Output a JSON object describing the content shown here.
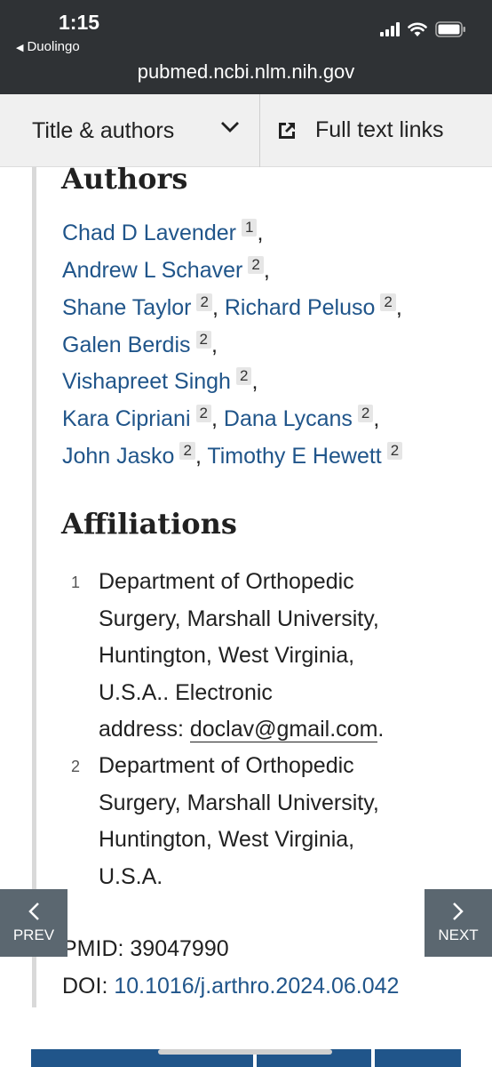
{
  "status": {
    "time": "1:15",
    "back_app": "Duolingo"
  },
  "url": "pubmed.ncbi.nlm.nih.gov",
  "toolbar": {
    "title_authors": "Title & authors",
    "full_text": "Full text links"
  },
  "authors_heading": "Authors",
  "authors": {
    "a1": {
      "name": "Chad D Lavender",
      "sup": "1"
    },
    "a2": {
      "name": "Andrew L Schaver",
      "sup": "2"
    },
    "a3": {
      "name": "Shane Taylor",
      "sup": "2"
    },
    "a4": {
      "name": "Richard Peluso",
      "sup": "2"
    },
    "a5": {
      "name": "Galen Berdis",
      "sup": "2"
    },
    "a6": {
      "name": "Vishapreet Singh",
      "sup": "2"
    },
    "a7": {
      "name": "Kara Cipriani",
      "sup": "2"
    },
    "a8": {
      "name": "Dana Lycans",
      "sup": "2"
    },
    "a9": {
      "name": "John Jasko",
      "sup": "2"
    },
    "a10": {
      "name": "Timothy E Hewett",
      "sup": "2"
    }
  },
  "affiliations_heading": "Affiliations",
  "affiliations": {
    "one": {
      "num": "1",
      "l1": "Department of Orthopedic",
      "l2": "Surgery, Marshall University,",
      "l3": "Huntington, West Virginia,",
      "l4": "U.S.A.. Electronic",
      "l5_prefix": "address: ",
      "email": "doclav@gmail.com",
      "l5_suffix": "."
    },
    "two": {
      "num": "2",
      "l1": "Department of Orthopedic",
      "l2": "Surgery, Marshall University,",
      "l3": "Huntington, West Virginia,",
      "l4": "U.S.A."
    }
  },
  "pmid_label": "PMID: ",
  "pmid": "39047990",
  "doi_label": "DOI: ",
  "doi": "10.1016/j.arthro.2024.06.042",
  "nav": {
    "prev": "PREV",
    "next": "NEXT"
  }
}
